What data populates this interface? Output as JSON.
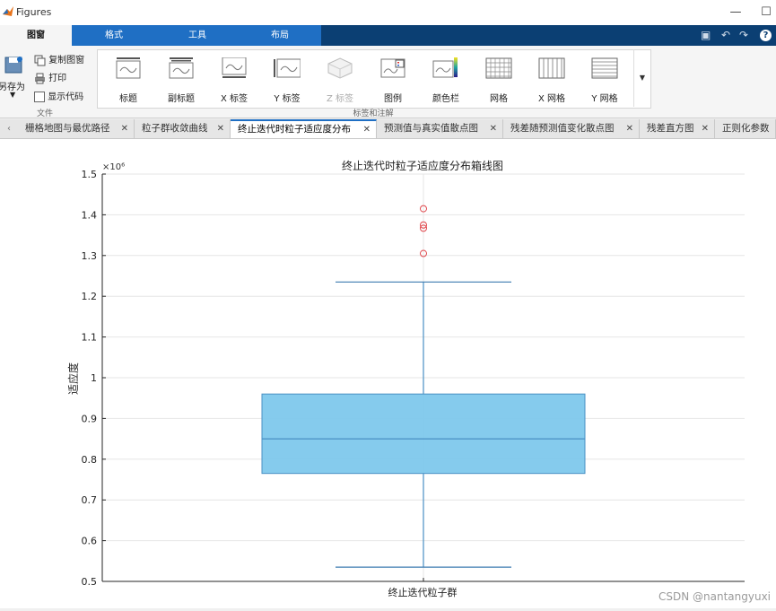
{
  "window": {
    "title": "Figures"
  },
  "menu": {
    "tabs": [
      {
        "label": "图窗",
        "active": true
      },
      {
        "label": "格式",
        "active": false
      },
      {
        "label": "工具",
        "active": false
      },
      {
        "label": "布局",
        "active": false
      }
    ]
  },
  "ribbon": {
    "file": {
      "save_as": "另存为",
      "copy_figure": "复制图窗",
      "print": "打印",
      "show_code": "显示代码",
      "group_label": "文件"
    },
    "labels_group": {
      "group_label": "标签和注解",
      "items": [
        {
          "label": "标题",
          "icon": "title-icon"
        },
        {
          "label": "副标题",
          "icon": "subtitle-icon"
        },
        {
          "label": "X 标签",
          "icon": "xlabel-icon"
        },
        {
          "label": "Y 标签",
          "icon": "ylabel-icon"
        },
        {
          "label": "Z 标签",
          "icon": "zlabel-icon"
        },
        {
          "label": "图例",
          "icon": "legend-icon"
        },
        {
          "label": "颜色栏",
          "icon": "colorbar-icon"
        },
        {
          "label": "网格",
          "icon": "grid-icon"
        },
        {
          "label": "X 网格",
          "icon": "xgrid-icon"
        },
        {
          "label": "Y 网格",
          "icon": "ygrid-icon"
        }
      ]
    }
  },
  "figure_tabs": [
    {
      "label": "栅格地图与最优路径",
      "active": false
    },
    {
      "label": "粒子群收敛曲线",
      "active": false
    },
    {
      "label": "终止迭代时粒子适应度分布",
      "active": true
    },
    {
      "label": "预测值与真实值散点图",
      "active": false
    },
    {
      "label": "残差随预测值变化散点图",
      "active": false
    },
    {
      "label": "残差直方图",
      "active": false
    },
    {
      "label": "正则化参数",
      "active": false
    }
  ],
  "chart_data": {
    "type": "box",
    "title": "终止迭代时粒子适应度分布箱线图",
    "xlabel": "",
    "ylabel": "适应度",
    "exponent_label": "×10⁶",
    "categories": [
      "终止迭代粒子群"
    ],
    "ylim": [
      0.5,
      1.5
    ],
    "yticks": [
      0.5,
      0.6,
      0.7,
      0.8,
      0.9,
      1.0,
      1.1,
      1.2,
      1.3,
      1.4,
      1.5
    ],
    "ytick_labels": [
      "0.5",
      "0.6",
      "0.7",
      "0.8",
      "0.9",
      "1",
      "1.1",
      "1.2",
      "1.3",
      "1.4",
      "1.5"
    ],
    "box": {
      "whisker_low": 0.535,
      "q1": 0.765,
      "median": 0.85,
      "q3": 0.96,
      "whisker_high": 1.235
    },
    "outliers": [
      1.305,
      1.367,
      1.375,
      1.415
    ],
    "grid": true,
    "colors": {
      "box_fill": "#7ec8ec",
      "box_edge": "#4a90c4",
      "outlier": "#e0474c",
      "grid": "#e6e6e6"
    }
  },
  "watermark": "CSDN @nantangyuxi"
}
